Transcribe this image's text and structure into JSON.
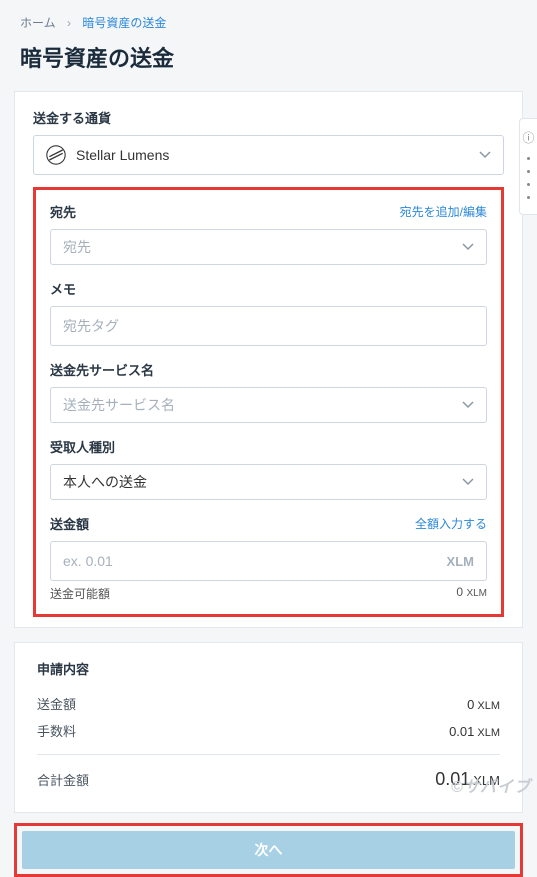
{
  "breadcrumb": {
    "home": "ホーム",
    "current": "暗号資産の送金"
  },
  "title": "暗号資産の送金",
  "currency": {
    "label": "送金する通貨",
    "value": "Stellar Lumens",
    "icon": "xlm-icon"
  },
  "dest": {
    "label": "宛先",
    "edit_link": "宛先を追加/編集",
    "placeholder": "宛先"
  },
  "memo": {
    "label": "メモ",
    "placeholder": "宛先タグ"
  },
  "service": {
    "label": "送金先サービス名",
    "placeholder": "送金先サービス名"
  },
  "recipient": {
    "label": "受取人種別",
    "value": "本人への送金"
  },
  "amount": {
    "label": "送金額",
    "full_link": "全額入力する",
    "placeholder": "ex. 0.01",
    "unit": "XLM",
    "avail_label": "送金可能額",
    "avail_val": "0",
    "avail_unit": "XLM"
  },
  "summary": {
    "label": "申請内容",
    "send_label": "送金額",
    "send_val": "0",
    "send_unit": "XLM",
    "fee_label": "手数料",
    "fee_val": "0.01",
    "fee_unit": "XLM",
    "total_label": "合計金額",
    "total_val": "0.01",
    "total_unit": "XLM"
  },
  "button": {
    "next": "次へ"
  },
  "watermark": "©サバイブ"
}
